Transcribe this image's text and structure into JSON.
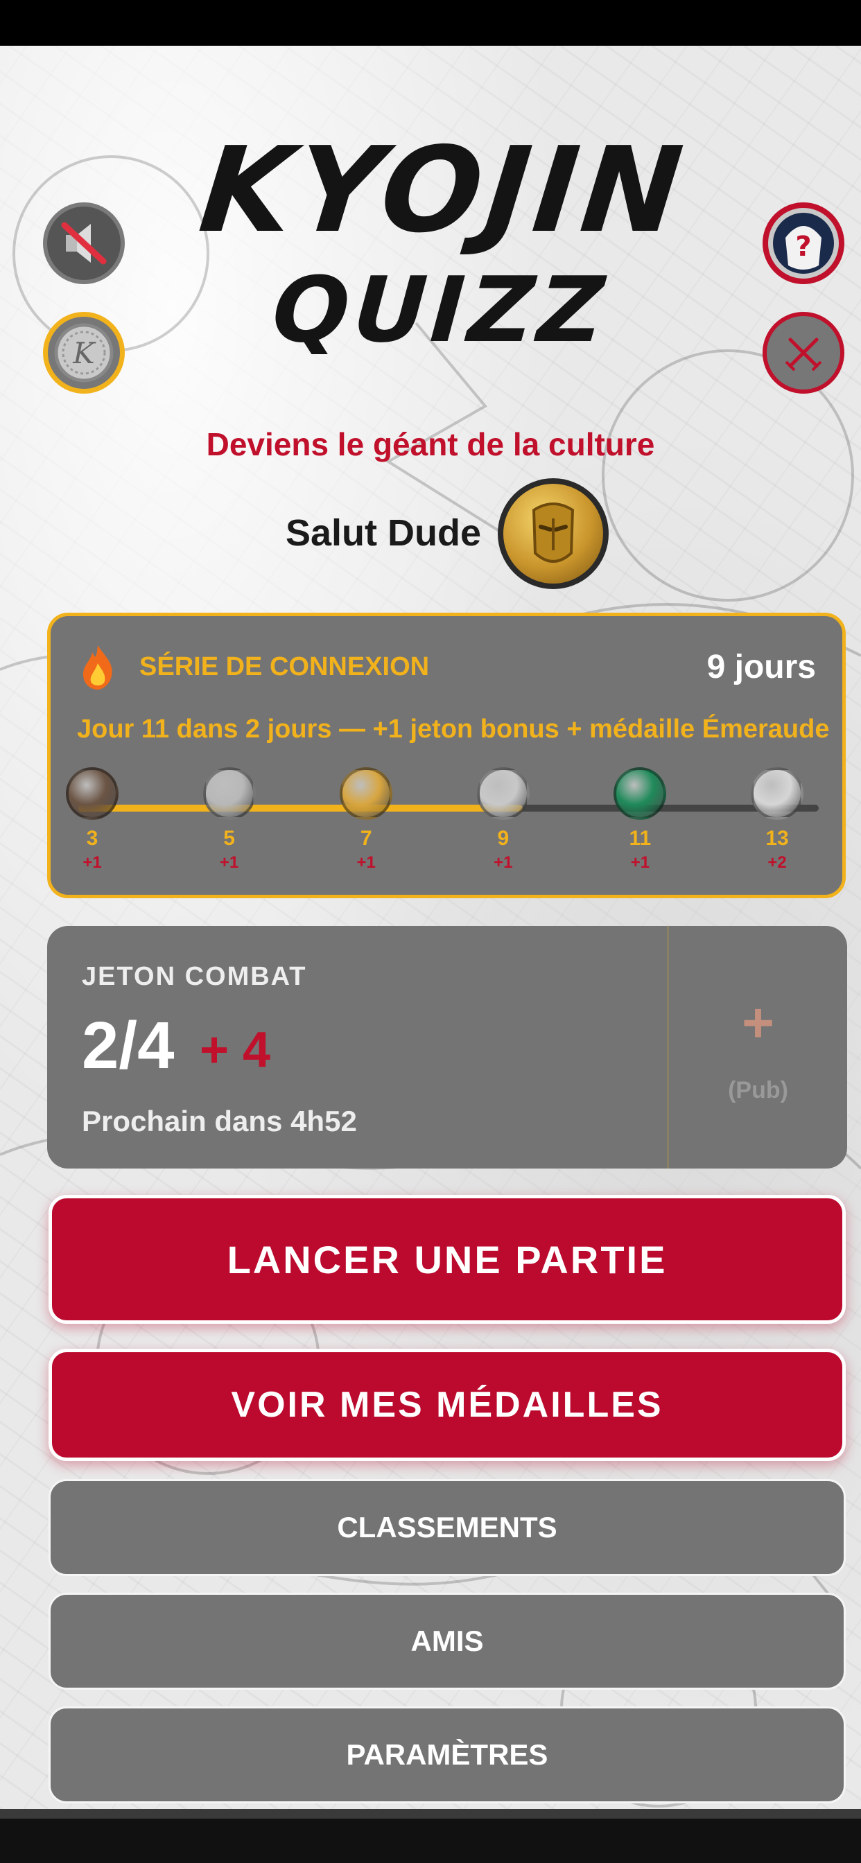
{
  "app": {
    "logo_line1": "KYOJIN",
    "logo_line2": "QUIZZ",
    "tagline": "Deviens le géant de la culture",
    "greeting": "Salut Dude"
  },
  "side_buttons": {
    "sound": "sound-muted-icon",
    "coin": "k-coin-icon",
    "profile": "masked-avatar-icon",
    "versus": "crossed-swords-icon"
  },
  "streak": {
    "title": "SÉRIE DE CONNEXION",
    "days": "9 jours",
    "subtitle": "Jour 11 dans 2 jours — +1 jeton bonus + médaille Émeraude",
    "progress_fraction": 0.6,
    "milestones": [
      {
        "day": "3",
        "bonus": "+1",
        "medal": "bronze",
        "color": "#6b5444"
      },
      {
        "day": "5",
        "bonus": "+1",
        "medal": "silver",
        "color": "#b8b8b8"
      },
      {
        "day": "7",
        "bonus": "+1",
        "medal": "gold",
        "color": "#d8a640"
      },
      {
        "day": "9",
        "bonus": "+1",
        "medal": "silver",
        "color": "#c8c8c8"
      },
      {
        "day": "11",
        "bonus": "+1",
        "medal": "emerald",
        "color": "#1f8a5a"
      },
      {
        "day": "13",
        "bonus": "+2",
        "medal": "diamond",
        "color": "#d6d6d6"
      }
    ]
  },
  "token": {
    "label": "JETON COMBAT",
    "count": "2/4",
    "extra": "+ 4",
    "next": "Prochain dans 4h52",
    "add_symbol": "+",
    "add_label": "(Pub)"
  },
  "buttons": {
    "play": "LANCER UNE PARTIE",
    "medals": "VOIR MES MÉDAILLES",
    "rankings": "CLASSEMENTS",
    "friends": "AMIS",
    "settings": "PARAMÈTRES"
  },
  "colors": {
    "accent_red": "#bb0a2e",
    "accent_gold": "#f2b21c",
    "card_grey": "#747474"
  }
}
